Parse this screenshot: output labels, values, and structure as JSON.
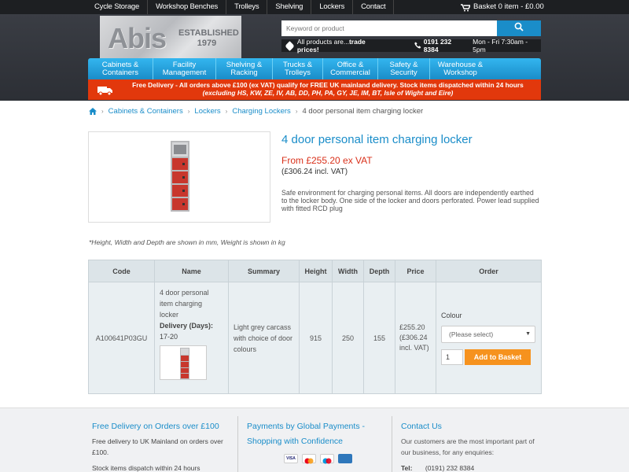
{
  "topnav": {
    "items": [
      "Cycle Storage",
      "Workshop Benches",
      "Trolleys",
      "Shelving",
      "Lockers",
      "Contact"
    ],
    "basket": "Basket 0 item - £0.00"
  },
  "header": {
    "logo_text": "Abis",
    "logo_established": "ESTABLISHED",
    "logo_year": "1979",
    "search_placeholder": "Keyword or product",
    "trade_text_normal": "All products are...",
    "trade_text_bold": "trade prices!",
    "phone": "0191 232 8384",
    "hours": "Mon - Fri 7:30am - 5pm"
  },
  "categories": [
    {
      "l1": "Cabinets &",
      "l2": "Containers"
    },
    {
      "l1": "Facility",
      "l2": "Management"
    },
    {
      "l1": "Shelving &",
      "l2": "Racking"
    },
    {
      "l1": "Trucks &",
      "l2": "Trolleys"
    },
    {
      "l1": "Office &",
      "l2": "Commercial"
    },
    {
      "l1": "Safety &",
      "l2": "Security"
    },
    {
      "l1": "Warehouse &",
      "l2": "Workshop"
    }
  ],
  "delivery": {
    "line1": "Free Delivery - All orders above £100 (ex VAT) qualify for FREE UK mainland delivery. Stock items dispatched within 24 hours",
    "line2": "(excluding HS, KW, ZE, IV, AB, DD, PH, PA, GY, JE, IM, BT, Isle of Wight and Eire)"
  },
  "breadcrumb": {
    "items": [
      "Cabinets & Containers",
      "Lockers",
      "Charging Lockers"
    ],
    "current": "4 door personal item charging locker"
  },
  "product": {
    "title": "4 door personal item charging locker",
    "price": "From £255.20 ex VAT",
    "price_vat": "(£306.24 incl. VAT)",
    "description": "Safe environment for charging personal items. All doors are independently earthed to the locker body. One side of the locker and doors perforated. Power lead supplied with fitted RCD plug",
    "note": "*Height, Width and Depth are shown in mm, Weight is shown in kg"
  },
  "table": {
    "headers": [
      "Code",
      "Name",
      "Summary",
      "Height",
      "Width",
      "Depth",
      "Price",
      "Order"
    ],
    "row": {
      "code": "A100641P03GU",
      "name": "4 door personal item charging locker",
      "delivery_label": "Delivery (Days):",
      "delivery_days": "17-20",
      "summary": "Light grey carcass with choice of door colours",
      "height": "915",
      "width": "250",
      "depth": "155",
      "price": "£255.20",
      "price_vat": "(£306.24 incl. VAT)",
      "colour_label": "Colour",
      "colour_select": "(Please select)",
      "qty": "1",
      "add_button": "Add to Basket"
    }
  },
  "footer": {
    "col1": {
      "title": "Free Delivery on Orders over £100",
      "text1": "Free delivery to UK Mainland on orders over £100.",
      "text2": "Stock items dispatch within 24 hours"
    },
    "col2": {
      "title": "Payments by Global Payments - Shopping with Confidence",
      "cards": [
        "VISA",
        "Mastercard",
        "Maestro",
        "American Express"
      ]
    },
    "col3": {
      "title": "Contact Us",
      "text": "Our customers are the most important part of our business, for any enquiries:",
      "tel_label": "Tel:",
      "tel": "(0191) 232 8384"
    }
  },
  "colors": {
    "accent_blue": "#1a8dc9",
    "delivery_red": "#e2380c",
    "price_red": "#d9301a",
    "button_orange": "#f6921e",
    "topbar": "#1d1f22"
  }
}
